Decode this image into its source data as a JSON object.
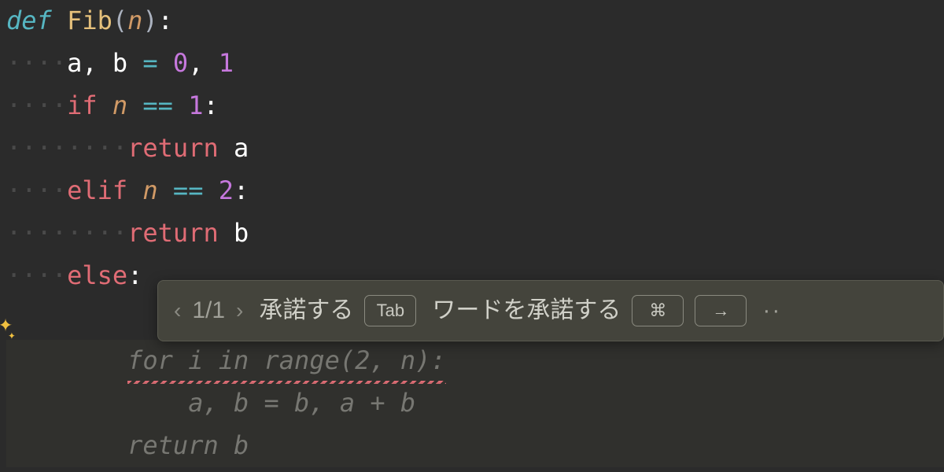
{
  "code": {
    "l1": {
      "def": "def",
      "sp": " ",
      "fn": "Fib",
      "lp": "(",
      "param": "n",
      "rp": ")",
      "colon": ":"
    },
    "l2": {
      "indent": "····",
      "a": "a",
      "c1": ",",
      "sp1": " ",
      "b": "b",
      "sp2": " ",
      "eq": "=",
      "sp3": " ",
      "z": "0",
      "c2": ",",
      "sp4": " ",
      "one": "1"
    },
    "l3": {
      "indent": "····",
      "if": "if",
      "sp1": " ",
      "n": "n",
      "sp2": " ",
      "eq": "==",
      "sp3": " ",
      "one": "1",
      "colon": ":"
    },
    "l4": {
      "indent": "········",
      "ret": "return",
      "sp": " ",
      "a": "a"
    },
    "l5": {
      "indent": "····",
      "elif": "elif",
      "sp1": " ",
      "n": "n",
      "sp2": " ",
      "eq": "==",
      "sp3": " ",
      "two": "2",
      "colon": ":"
    },
    "l6": {
      "indent": "········",
      "ret": "return",
      "sp": " ",
      "b": "b"
    },
    "l7": {
      "indent": "····",
      "else": "else",
      "colon": ":"
    },
    "g1": {
      "indent": "········",
      "text": "for i in range(2, n):"
    },
    "g2": {
      "indent": "············",
      "text": "a, b = b, a + b"
    },
    "g3": {
      "indent": "········",
      "text": "return b"
    }
  },
  "hint": {
    "prev_icon": "‹",
    "counter": "1/1",
    "next_icon": "›",
    "accept": "承諾する",
    "tab_key": "Tab",
    "accept_word": "ワードを承諾する",
    "cmd_key": "⌘",
    "arrow_key": "→",
    "more": "··"
  },
  "gutter": {
    "sparkle": "✦"
  }
}
